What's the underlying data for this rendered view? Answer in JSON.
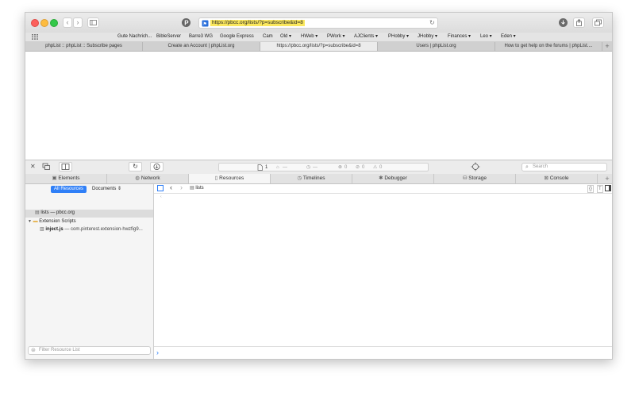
{
  "browser": {
    "url": "https://pbcc.org/lists/?p=subscribe&id=8",
    "bookmarks": [
      "Gute Nachrich...",
      "BibleServer",
      "Barre3 WG",
      "Google Express",
      "Cam",
      "Old ▾",
      "HWeb ▾",
      "PWork ▾",
      "AJClients ▾",
      "PHobby ▾",
      "JHobby ▾",
      "Finances ▾",
      "Leo ▾",
      "Eden ▾"
    ],
    "tabs": [
      {
        "title": "phpList :: phpList :: Subscribe pages",
        "active": false
      },
      {
        "title": "Create an Account | phpList.org",
        "active": false
      },
      {
        "title": "https://pbcc.org/lists/?p=subscribe&id=8",
        "active": true
      },
      {
        "title": "Users | phpList.org",
        "active": false
      },
      {
        "title": "How to get help on the forums | phpList....",
        "active": false
      }
    ],
    "new_tab": "+"
  },
  "devtools": {
    "dashboard": {
      "resources": "1",
      "load": "—",
      "time": "—",
      "errors": "0",
      "warnings": "0",
      "logs": "0"
    },
    "search_placeholder": "Search",
    "tabs": [
      "Elements",
      "Network",
      "Resources",
      "Timelines",
      "Debugger",
      "Storage",
      "Console"
    ],
    "active_tab": "Resources",
    "sidebar": {
      "scope_all": "All Resources",
      "scope_docs": "Documents ⇕",
      "items": {
        "main_doc": "lists — pbcc.org",
        "ext_folder": "Extension Scripts",
        "ext_script": "inject.js",
        "ext_script_source": "— com.pinterest.extension-hwzfig9..."
      },
      "filter_placeholder": "Filter Resource List"
    },
    "path": {
      "file": "lists"
    },
    "console_prompt": "›"
  },
  "colors": {
    "accent": "#2f7ff7",
    "url_highlight": "#fbe85d"
  }
}
